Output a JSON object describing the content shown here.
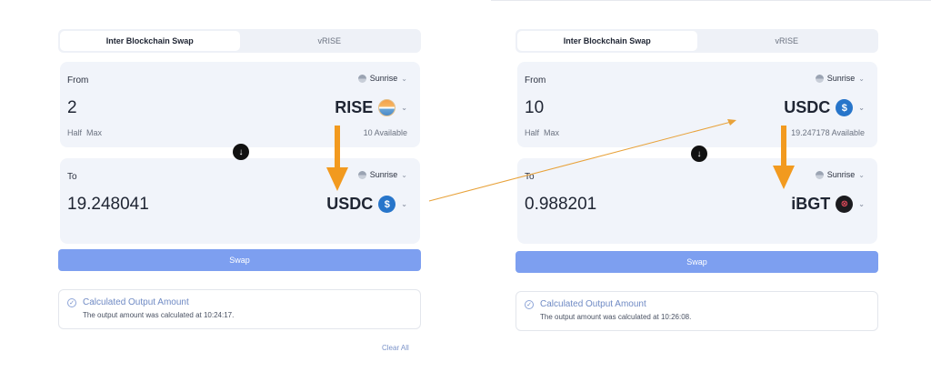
{
  "left": {
    "tabs": [
      {
        "label": "Inter Blockchain Swap",
        "active": true
      },
      {
        "label": "vRISE",
        "active": false
      }
    ],
    "from": {
      "label": "From",
      "network": "Sunrise",
      "amount": "2",
      "token": "RISE",
      "token_icon": "rise-token-icon",
      "half": "Half",
      "max": "Max",
      "available": "10  Available"
    },
    "to": {
      "label": "To",
      "network": "Sunrise",
      "amount": "19.248041",
      "token": "USDC",
      "token_icon": "usdc-token-icon"
    },
    "swap_label": "Swap",
    "status": {
      "title": "Calculated Output Amount",
      "message": "The output amount was calculated at 10:24:17."
    },
    "clear_all": "Clear All"
  },
  "right": {
    "tabs": [
      {
        "label": "Inter Blockchain Swap",
        "active": true
      },
      {
        "label": "vRISE",
        "active": false
      }
    ],
    "from": {
      "label": "From",
      "network": "Sunrise",
      "amount": "10",
      "token": "USDC",
      "token_icon": "usdc-token-icon",
      "half": "Half",
      "max": "Max",
      "available": "19.247178  Available"
    },
    "to": {
      "label": "To",
      "network": "Sunrise",
      "amount": "0.988201",
      "token": "iBGT",
      "token_icon": "ibgt-token-icon"
    },
    "swap_label": "Swap",
    "status": {
      "title": "Calculated Output Amount",
      "message": "The output amount was calculated at 10:26:08."
    }
  },
  "colors": {
    "accent": "#7d9ff0",
    "annotation_arrow": "#f29a1f",
    "card_bg": "#f1f4fa",
    "status_title": "#6f8ac4"
  }
}
